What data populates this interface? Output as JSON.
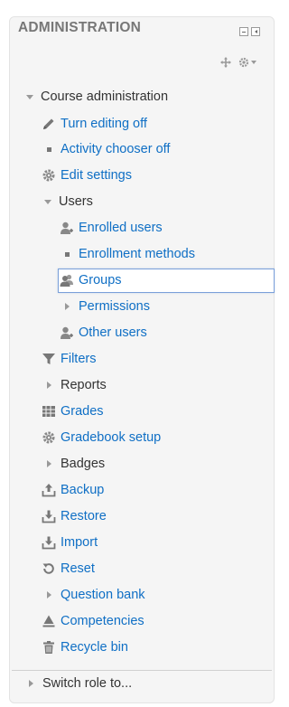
{
  "block": {
    "title": "ADMINISTRATION"
  },
  "tree": {
    "course_admin": "Course administration",
    "turn_editing_off": "Turn editing off",
    "activity_chooser_off": "Activity chooser off",
    "edit_settings": "Edit settings",
    "users": "Users",
    "enrolled_users": "Enrolled users",
    "enrollment_methods": "Enrollment methods",
    "groups": "Groups",
    "permissions": "Permissions",
    "other_users": "Other users",
    "filters": "Filters",
    "reports": "Reports",
    "grades": "Grades",
    "gradebook_setup": "Gradebook setup",
    "badges": "Badges",
    "backup": "Backup",
    "restore": "Restore",
    "import": "Import",
    "reset": "Reset",
    "question_bank": "Question bank",
    "competencies": "Competencies",
    "recycle_bin": "Recycle bin",
    "switch_role": "Switch role to..."
  },
  "colors": {
    "link": "#0f6fc5",
    "text": "#333333",
    "title": "#777777",
    "icon": "#8a8a8a",
    "selected_border": "#7ba0d9"
  },
  "icons": {
    "dock_minimize": "minimize-icon",
    "dock_side": "dock-icon",
    "move": "move-icon",
    "settings": "gear-icon"
  }
}
